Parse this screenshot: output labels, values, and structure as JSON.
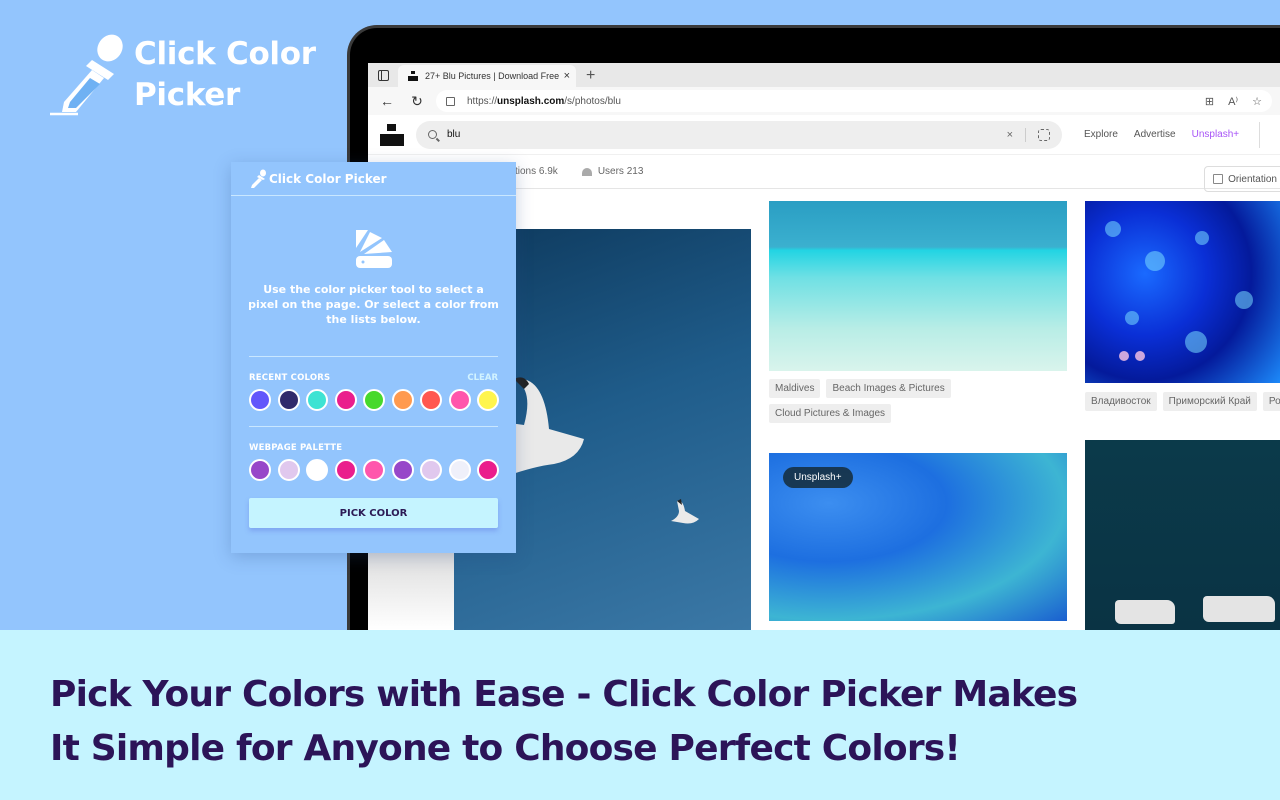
{
  "brand": {
    "title_line1": "Click Color",
    "title_line2": "Picker",
    "icon": "eyedropper-icon"
  },
  "browser": {
    "tab_title": "27+ Blu Pictures | Download Free",
    "tab_close": "×",
    "new_tab": "+",
    "back": "←",
    "reload": "↻",
    "url_prefix": "https://",
    "url_host": "unsplash.com",
    "url_path": "/s/photos/blu",
    "url_actions": [
      "app-available-icon",
      "read-aloud-icon",
      "favorites-icon"
    ],
    "url_action_glyphs": [
      "⊞",
      "A⁾",
      "☆"
    ]
  },
  "unsplash": {
    "search_value": "blu",
    "search_clear": "×",
    "nav": [
      "Explore",
      "Advertise",
      "Unsplash+"
    ],
    "sub_tabs": {
      "collections": "ctions 6.9k",
      "users": "Users 213"
    },
    "orientation": "Orientation",
    "beach_tags": [
      "Maldives",
      "Beach Images & Pictures",
      "Cloud Pictures & Images"
    ],
    "bokeh_tags": [
      "Владивосток",
      "Приморский Край",
      "Ро"
    ],
    "plus_badge": "Unsplash+"
  },
  "popup": {
    "title": "Click Color Picker",
    "description": "Use the color picker tool to select a pixel on the page. Or select a color from the lists below.",
    "recent_label": "RECENT COLORS",
    "clear_label": "CLEAR",
    "recent_colors": [
      "#6257fb",
      "#302a6b",
      "#3ee3d3",
      "#ea1e8c",
      "#47d92c",
      "#ff9a4f",
      "#ff5750",
      "#ff56ac",
      "#fff54d"
    ],
    "palette_label": "WEBPAGE PALETTE",
    "palette_colors": [
      "#9747c9",
      "#e0c8ee",
      "#ffffff",
      "#ea1e8c",
      "#ff56ac",
      "#9747c9",
      "#e0c8ee",
      "#eff0fa",
      "#ea1e8c"
    ],
    "pick_button": "PICK COLOR"
  },
  "banner": {
    "line1": "Pick Your Colors with Ease - Click Color Picker Makes",
    "line2": "It Simple for Anyone to Choose Perfect Colors!"
  },
  "colors": {
    "background": "#93c5fd",
    "banner_bg": "#c5f4ff",
    "banner_text": "#2c1458",
    "accent_plus": "#a855f7"
  }
}
